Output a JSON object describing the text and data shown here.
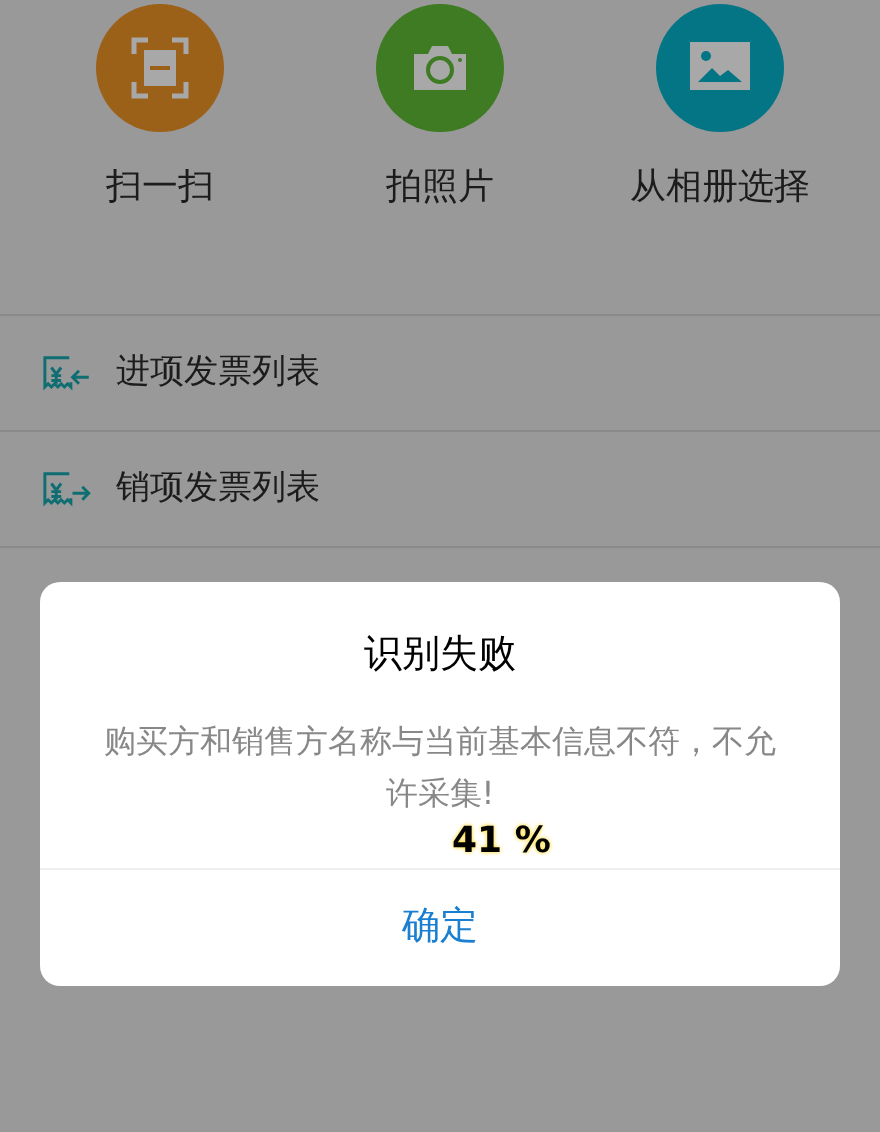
{
  "actions": [
    {
      "label": "扫一扫",
      "kind": "scan",
      "color": "#9c6119"
    },
    {
      "label": "拍照片",
      "kind": "camera",
      "color": "#3e7b22"
    },
    {
      "label": "从相册选择",
      "kind": "album",
      "color": "#037585"
    }
  ],
  "menu": [
    {
      "label": "进项发票列表",
      "kind": "incoming"
    },
    {
      "label": "销项发票列表",
      "kind": "outgoing"
    }
  ],
  "dialog": {
    "title": "识别失败",
    "message": "购买方和销售方名称与当前基本信息不符，不允许采集!",
    "button": "确定"
  },
  "progress": "41 %"
}
